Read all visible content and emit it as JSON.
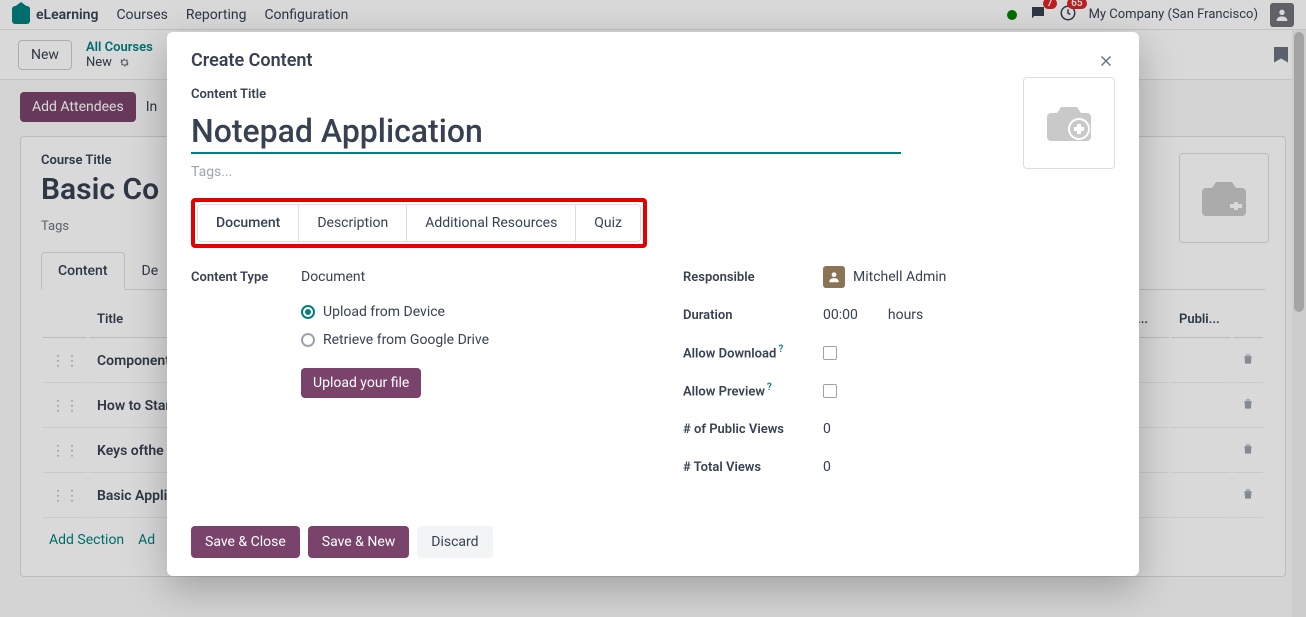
{
  "brand": "eLearning",
  "nav": {
    "courses": "Courses",
    "reporting": "Reporting",
    "configuration": "Configuration"
  },
  "topbar": {
    "chat_badge": "7",
    "clock_badge": "65",
    "company": "My Company (San Francisco)"
  },
  "secbar": {
    "new": "New",
    "breadcrumb_top": "All Courses",
    "breadcrumb_bot": "New"
  },
  "page": {
    "add_attendees": "Add Attendees",
    "invite_partial": "In",
    "course_label": "Course Title",
    "course_title": "Basic Co",
    "tags_label": "Tags",
    "tabs": {
      "content": "Content",
      "desc": "De"
    },
    "table": {
      "col_title": "Title",
      "col_dots": "...",
      "col_publ": "Publi...",
      "rows": [
        "Components of a",
        "How to Start a C",
        "Keys ofthe Keyp",
        "Basic Applicatio"
      ]
    },
    "add_section": "Add Section",
    "add_more": "Ad"
  },
  "modal": {
    "title": "Create Content",
    "content_title_label": "Content Title",
    "content_title_value": "Notepad Application",
    "tags_placeholder": "Tags...",
    "tabs": {
      "document": "Document",
      "description": "Description",
      "additional": "Additional Resources",
      "quiz": "Quiz"
    },
    "left": {
      "content_type_label": "Content Type",
      "content_type_value": "Document",
      "upload_device": "Upload from Device",
      "retrieve_drive": "Retrieve from Google Drive",
      "upload_btn": "Upload your file"
    },
    "right": {
      "responsible_label": "Responsible",
      "responsible_value": "Mitchell Admin",
      "duration_label": "Duration",
      "duration_value": "00:00",
      "duration_unit": "hours",
      "allow_download_label": "Allow Download",
      "allow_preview_label": "Allow Preview",
      "public_views_label": "# of Public Views",
      "public_views_value": "0",
      "total_views_label": "# Total Views",
      "total_views_value": "0"
    },
    "footer": {
      "save_close": "Save & Close",
      "save_new": "Save & New",
      "discard": "Discard"
    }
  }
}
